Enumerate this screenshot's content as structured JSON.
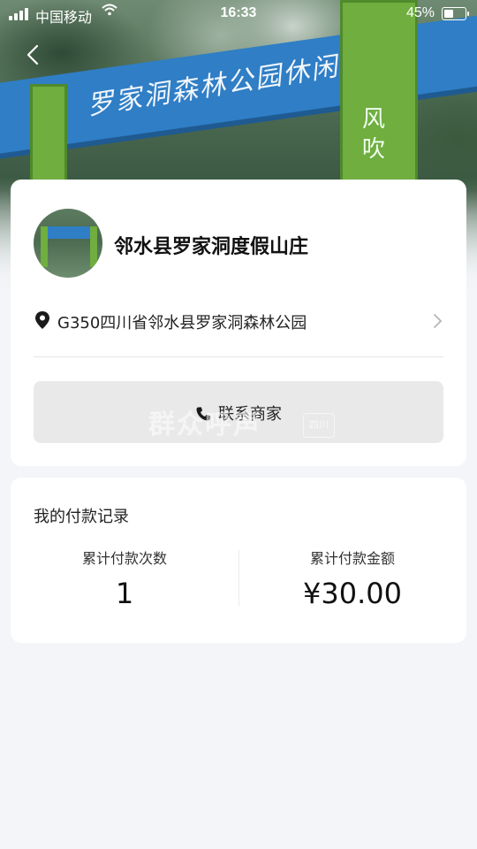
{
  "status_bar": {
    "carrier": "中国移动",
    "time": "16:33",
    "battery_percent": "45%",
    "battery_level": 0.45
  },
  "hero": {
    "sign_text": "罗家洞森林公园休闲山庄",
    "pillar_text": "风吹"
  },
  "merchant": {
    "name": "邻水县罗家洞度假山庄",
    "address": "G350四川省邻水县罗家洞森林公园",
    "contact_label": "联系商家",
    "watermark": "群众呼声",
    "watermark_badge": "四川"
  },
  "records": {
    "title": "我的付款记录",
    "count_label": "累计付款次数",
    "count_value": "1",
    "amount_label": "累计付款金额",
    "amount_value": "¥30.00"
  },
  "icons": {
    "back": "chevron-left-icon",
    "location": "location-pin-icon",
    "arrow": "chevron-right-icon",
    "phone": "phone-icon"
  }
}
